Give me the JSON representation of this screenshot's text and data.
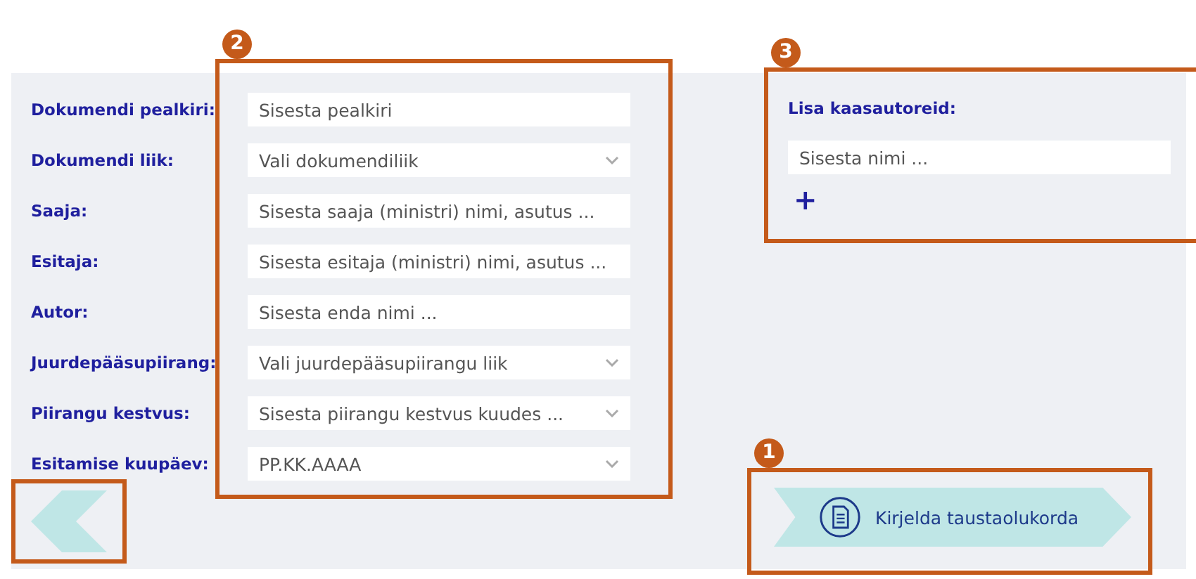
{
  "form": {
    "callout": "2",
    "highlighted": true,
    "fields": [
      {
        "label": "Dokumendi pealkiri:",
        "placeholder": "Sisesta pealkiri",
        "kind": "text"
      },
      {
        "label": "Dokumendi liik:",
        "placeholder": "Vali dokumendiliik",
        "kind": "select"
      },
      {
        "label": "Saaja:",
        "placeholder": "Sisesta saaja (ministri) nimi, asutus ...",
        "kind": "text"
      },
      {
        "label": "Esitaja:",
        "placeholder": "Sisesta esitaja (ministri) nimi, asutus ...",
        "kind": "text"
      },
      {
        "label": "Autor:",
        "placeholder": "Sisesta enda nimi ...",
        "kind": "text"
      },
      {
        "label": "Juurdepääsupiirang:",
        "placeholder": "Vali juurdepääsupiirangu liik",
        "kind": "select"
      },
      {
        "label": "Piirangu kestvus:",
        "placeholder": "Sisesta piirangu kestvus kuudes ...",
        "kind": "select"
      },
      {
        "label": "Esitamise kuupäev:",
        "placeholder": "PP.KK.AAAA",
        "kind": "select"
      }
    ]
  },
  "coauthors": {
    "callout": "3",
    "highlighted": true,
    "label": "Lisa kaasautoreid:",
    "placeholder": "Sisesta nimi ...",
    "add": "+"
  },
  "back_button": {
    "highlighted": true
  },
  "next_button": {
    "callout": "1",
    "highlighted": true,
    "label": "Kirjelda taustaolukorda"
  }
}
